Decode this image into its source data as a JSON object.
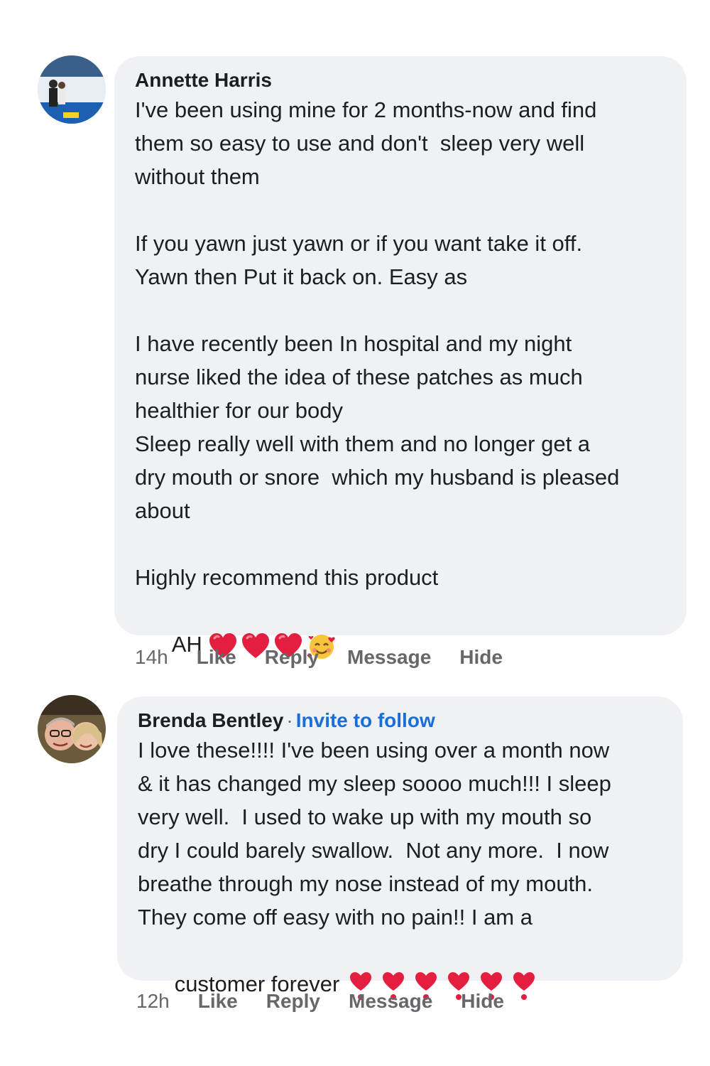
{
  "comments": [
    {
      "author": "Annette Harris",
      "invite": "",
      "paragraphs": [
        "I've been using mine for 2 months-now and find\nthem so easy to use and don't  sleep very well\nwithout them",
        "If you yawn just yawn or if you want take it off.\nYawn then Put it back on. Easy as",
        "I have recently been In hospital and my night\nnurse liked the idea of these patches as much\nhealthier for our body\nSleep really well with them and no longer get a\ndry mouth or snore  which my husband is pleased\nabout",
        "Highly recommend this product"
      ],
      "signoff": "AH",
      "emojis": [
        "red-heart",
        "red-heart",
        "red-heart",
        "smiling-face-with-hearts"
      ],
      "time": "14h",
      "actions": {
        "like": "Like",
        "reply": "Reply",
        "message": "Message",
        "hide": "Hide"
      }
    },
    {
      "author": "Brenda Bentley",
      "separator": "·",
      "invite": "Invite to follow",
      "text": "I love these!!!! I've been using over a month now\n& it has changed my sleep soooo much!!! I sleep\nvery well.  I used to wake up with my mouth so\ndry I could barely swallow.  Not any more.  I now\nbreathe through my nose instead of my mouth.\nThey come off easy with no pain!! I am a",
      "last_line": "customer forever",
      "emojis": [
        "heart-exclamation",
        "heart-exclamation",
        "heart-exclamation",
        "heart-exclamation",
        "heart-exclamation",
        "heart-exclamation"
      ],
      "time": "12h",
      "actions": {
        "like": "Like",
        "reply": "Reply",
        "message": "Message",
        "hide": "Hide"
      }
    }
  ],
  "colors": {
    "bubble": "#f0f1f4",
    "meta": "#65676b",
    "link": "#1a6fd6",
    "heart": "#e41e3f"
  }
}
